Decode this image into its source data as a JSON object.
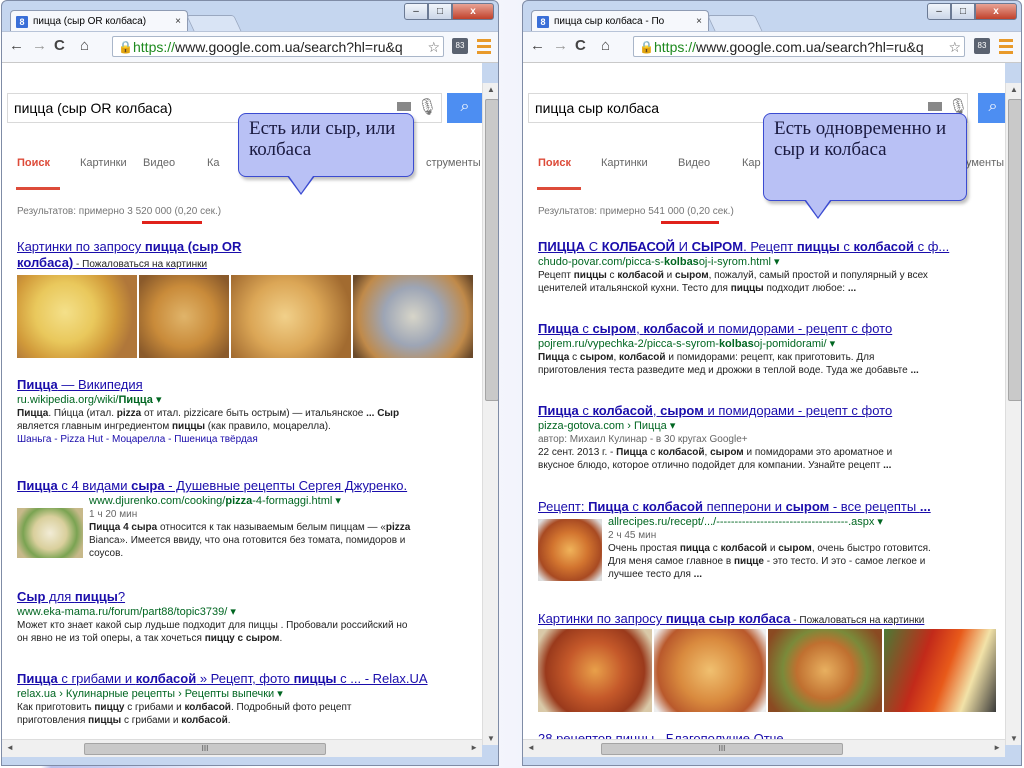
{
  "left": {
    "tab_title": "пицца (сыр OR колбаса)",
    "url_secure": "https://",
    "url_rest": "www.google.com.ua/search?hl=ru&q",
    "query": "пицца (сыр OR колбаса)",
    "nav_tabs": [
      "Поиск",
      "Картинки",
      "Видео",
      "Ка",
      "струменты"
    ],
    "stats_prefix": "Результатов: примерно ",
    "stats_count": "3 520 000",
    "stats_time": " (0,20 сек.)",
    "callout": "Есть или сыр, или колбаса",
    "img_block": {
      "title_a": "Картинки по запросу ",
      "title_b": "пицца (сыр OR",
      "title_c": "колбаса)",
      "report": " - Пожаловаться на картинки"
    },
    "results": [
      {
        "title_b": "Пицца",
        "title_rest": " — Википедия",
        "url_a": "ru.wikipedia.org/wiki/",
        "url_b": "Пицца",
        "s1_b": "Пицца",
        "s1": ". Пи́цца (итал. ",
        "s1_c": "pizza",
        "s1_d": " от итал. pizzicare быть острым) — итальянское ",
        "s1_e": "... Сыр",
        "s2": "является главным ингредиентом ",
        "s2_b": "пиццы",
        "s2_c": " (как правило, моцарелла).",
        "links": "Шаньга - Pizza Hut - Моцарелла - Пшеница твёрдая"
      },
      {
        "title_a": "Пицца",
        "title_b": " с 4 видами ",
        "title_c": "сыра",
        "title_d": " - Душевные рецепты Сергея Джуренко.",
        "url_a": "www.djurenko.com/cooking/",
        "url_b": "pizza",
        "url_c": "-4-formaggi.html",
        "meta": "1 ч 20 мин",
        "s1_b": "Пицца 4 сыра",
        "s1": " относится к так называемым белым пиццам — «",
        "s1_c": "pizza",
        "s2": "Bianca». Имеется ввиду, что она готовится без томата, помидоров и",
        "s3": "соусов."
      },
      {
        "title_a": "Сыр",
        "title_b": " для ",
        "title_c": "пиццы",
        "title_d": "?",
        "url_a": "www.eka-mama.ru/forum/part88/topic3739/",
        "s1": "Может кто знает какой сыр лудьше подходит для пиццы . Пробовали российский но",
        "s2": "он явно не из той оперы, а так хочеться ",
        "s2_b": "пиццу с сыром",
        "s2_c": "."
      },
      {
        "title_a": "Пицца",
        "title_b": " с грибами и ",
        "title_c": "колбасой",
        "title_d": " » Рецепт, фото ",
        "title_e": "пиццы",
        "title_f": " с ... - Relax.UA",
        "url_a": "relax.ua › Кулинарные рецепты › Рецепты выпечки",
        "s1": "Как приготовить ",
        "s1_b": "пиццу",
        "s1_c": " с грибами и ",
        "s1_d": "колбасой",
        "s1_e": ". Подробный фото рецепт",
        "s2": "приготовления ",
        "s2_b": "пиццы",
        "s2_c": " с грибами и ",
        "s2_d": "колбасой",
        "s2_e": "."
      }
    ]
  },
  "right": {
    "tab_title": "пицца сыр колбаса - По",
    "url_secure": "https://",
    "url_rest": "www.google.com.ua/search?hl=ru&q",
    "query": "пицца сыр колбаса",
    "nav_tabs": [
      "Поиск",
      "Картинки",
      "Видео",
      "Кар",
      "рументы"
    ],
    "stats_prefix": "Результатов: примерно ",
    "stats_count": "541 000",
    "stats_time": " (0,20 сек.)",
    "callout": "Есть одновременно и сыр и колбаса",
    "results": [
      {
        "title_a": "ПИЦЦА",
        "title_b": " С ",
        "title_c": "КОЛБАСОЙ",
        "title_d": " И ",
        "title_e": "СЫРОМ",
        "title_f": ". Рецепт ",
        "title_g": "пиццы",
        "title_h": " с ",
        "title_i": "колбасой",
        "title_j": " с ф...",
        "url_a": "chudo-povar.com/picca-s-",
        "url_b": "kolbas",
        "url_c": "oj-i-syrom.html",
        "s1": "Рецепт ",
        "s1_b": "пиццы",
        "s1_c": " с ",
        "s1_d": "колбасой",
        "s1_e": " и ",
        "s1_f": "сыром",
        "s1_g": ", пожалуй, самый простой и популярный у всех",
        "s2": "ценителей итальянской кухни. Тесто для ",
        "s2_b": "пиццы",
        "s2_c": " подходит любое: ",
        "s2_d": "..."
      },
      {
        "title_a": "Пицца",
        "title_b": " с ",
        "title_c": "сыром",
        "title_d": ", ",
        "title_e": "колбасой",
        "title_f": " и помидорами - рецепт с фото",
        "url_a": "pojrem.ru/vypechka-2/picca-s-syrom-",
        "url_b": "kolbas",
        "url_c": "oj-pomidorami/",
        "s1_b": "Пицца",
        "s1": " с ",
        "s1_c": "сыром",
        "s1_d": ", ",
        "s1_e": "колбасой",
        "s1_f": " и помидорами: рецепт, как приготовить. Для",
        "s2": "приготовления теста разведите мед и дрожжи в теплой воде. Туда же добавьте ",
        "s2_b": "..."
      },
      {
        "title_a": "Пицца",
        "title_b": " с ",
        "title_c": "колбасой",
        "title_d": ", ",
        "title_e": "сыром",
        "title_f": " и помидорами - рецепт с фото",
        "url_a": "pizza-gotova.com › Пицца",
        "meta": "автор: Михаил Кулинар - в 30 кругах Google+",
        "s1": "22 сент. 2013 г. - ",
        "s1_b": "Пицца",
        "s1_c": " с ",
        "s1_d": "колбасой",
        "s1_e": ", ",
        "s1_f": "сыром",
        "s1_g": " и помидорами это ароматное и",
        "s2": "вкусное блюдо, которое отлично подойдет для компании. Узнайте рецепт ",
        "s2_b": "..."
      },
      {
        "title_a": "Рецепт: ",
        "title_b": "Пицца",
        "title_c": " с ",
        "title_d": "колбасой",
        "title_e": " пепперони и ",
        "title_f": "сыром",
        "title_g": " - все рецепты ",
        "title_h": "...",
        "url_a": "allrecipes.ru/recept/.../------------------------------------.aspx",
        "meta": "2 ч 45 мин",
        "s1": "Очень простая ",
        "s1_b": "пицца",
        "s1_c": " с ",
        "s1_d": "колбасой",
        "s1_e": " и ",
        "s1_f": "сыром",
        "s1_g": ", очень быстро готовится.",
        "s2": "Для меня самое главное в ",
        "s2_b": "пицце",
        "s2_c": " - это тесто. И это - самое легкое и",
        "s3": "лучшее тесто для ",
        "s3_b": "..."
      }
    ],
    "img_block": {
      "title_a": "Картинки по запросу ",
      "title_b": "пицца сыр колбаса",
      "report": " - Пожаловаться на картинки"
    },
    "cut_title": "28 рецептов пиццы - Благополучие Отче"
  },
  "common": {
    "hscroll_label": "III"
  }
}
